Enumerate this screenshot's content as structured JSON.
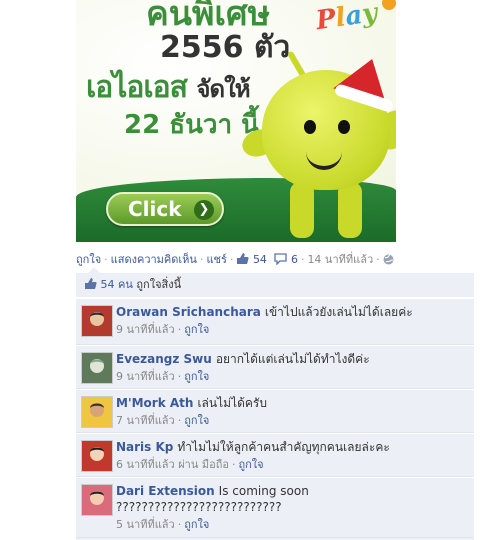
{
  "ad": {
    "line1": "คนพิเศษ",
    "line2": "2556 ตัว",
    "line3_a": "เอไอเอส",
    "line3_b": "จัดให้",
    "line4": "22 ธันวา นี้",
    "play_letters": [
      "P",
      "l",
      "a",
      "y"
    ],
    "click_label": "Click"
  },
  "actions": {
    "like": "ถูกใจ",
    "comment": "แสดงความคิดเห็น",
    "share": "แชร์",
    "like_count": "54",
    "comment_count": "6",
    "time": "14 นาทีที่แล้ว"
  },
  "panel": {
    "likes_count": "54 คน",
    "likes_text": "ถูกใจสิ่งนี้"
  },
  "comments": [
    {
      "name": "Orawan Srichanchara",
      "text": "เข้าไปแล้วยังเล่นไม่ได้เลยค่ะ",
      "time": "9 นาทีที่แล้ว",
      "via": "",
      "like": "ถูกใจ",
      "avatar_colors": [
        "#b23b2e",
        "#e8c6a0",
        "#2b2b2b"
      ]
    },
    {
      "name": "Evezangz Swu",
      "text": "อยากได้แต่เล่นไม่ได้ทำไงดีค่ะ",
      "time": "9 นาทีที่แล้ว",
      "via": "",
      "like": "ถูกใจ",
      "avatar_colors": [
        "#5f7a5a",
        "#dfe6d8",
        "#8aa38a"
      ]
    },
    {
      "name": "M'Mork Ath",
      "text": "เล่นไม่ได้ครับ",
      "time": "7 นาทีที่แล้ว",
      "via": "",
      "like": "ถูกใจ",
      "avatar_colors": [
        "#f0c640",
        "#d9a37a",
        "#333333"
      ]
    },
    {
      "name": "Naris Kp",
      "text": "ทำไมไม่ให้ลูกค้าคนสำคัญทุกคนเลยล่ะคะ",
      "time": "6 นาทีที่แล้ว",
      "via": "ผ่าน มือถือ",
      "like": "ถูกใจ",
      "avatar_colors": [
        "#c0392b",
        "#f1d3b5",
        "#1e1e1e"
      ]
    },
    {
      "name": "Dari Extension",
      "text": "Is coming soon ??????????????????????????",
      "time": "5 นาทีที่แล้ว",
      "via": "",
      "like": "ถูกใจ",
      "avatar_colors": [
        "#d96b7a",
        "#f3cdb0",
        "#222222"
      ]
    }
  ]
}
